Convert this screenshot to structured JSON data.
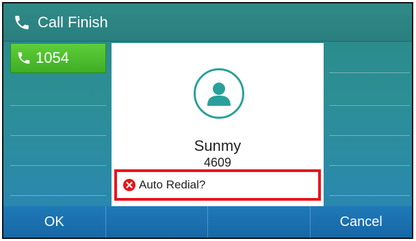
{
  "header": {
    "title": "Call Finish",
    "icon": "phone-icon"
  },
  "line_keys_left": [
    {
      "label": "1054",
      "active": true,
      "icon": "phone-icon",
      "color": "#4cbf2e"
    },
    {
      "label": ""
    },
    {
      "label": ""
    },
    {
      "label": ""
    },
    {
      "label": ""
    }
  ],
  "line_keys_right": [
    {
      "label": ""
    },
    {
      "label": ""
    },
    {
      "label": ""
    },
    {
      "label": ""
    },
    {
      "label": ""
    }
  ],
  "contact": {
    "name": "Sunmy",
    "number": "4609",
    "avatar_icon": "person-icon"
  },
  "prompt": {
    "text": "Auto Redial?",
    "icon": "close-circle-icon",
    "highlight_color": "#e8141b"
  },
  "softkeys": [
    "OK",
    "",
    "",
    "Cancel"
  ]
}
